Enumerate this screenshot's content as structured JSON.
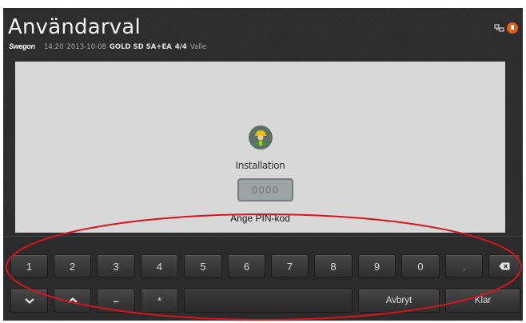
{
  "header": {
    "title": "Användarval",
    "logo": "Swegon",
    "status": {
      "time": "14:20",
      "date": "2013-10-08",
      "unit": "GOLD SD SA+EA",
      "pages": "4/4",
      "user": "Valle"
    }
  },
  "login": {
    "user_name": "Installation",
    "pin_placeholder": "0000",
    "pin_prompt": "Ange PIN-kod"
  },
  "keyboard": {
    "row1": [
      "1",
      "2",
      "3",
      "4",
      "5",
      "6",
      "7",
      "8",
      "9",
      "0",
      "."
    ],
    "minus_label": "–",
    "star_label": "*",
    "cancel_label": "Avbryt",
    "done_label": "Klar"
  },
  "colors": {
    "background": "#2d2d2d",
    "content_panel": "#d8d8d8",
    "avatar": "#5e6f65",
    "alarm": "#e85c14",
    "annotation_ellipse": "#d9141b"
  },
  "icons": [
    "network-icon",
    "alarm-icon",
    "user-avatar-icon",
    "backspace-icon",
    "arrow-down-icon",
    "arrow-up-icon"
  ]
}
